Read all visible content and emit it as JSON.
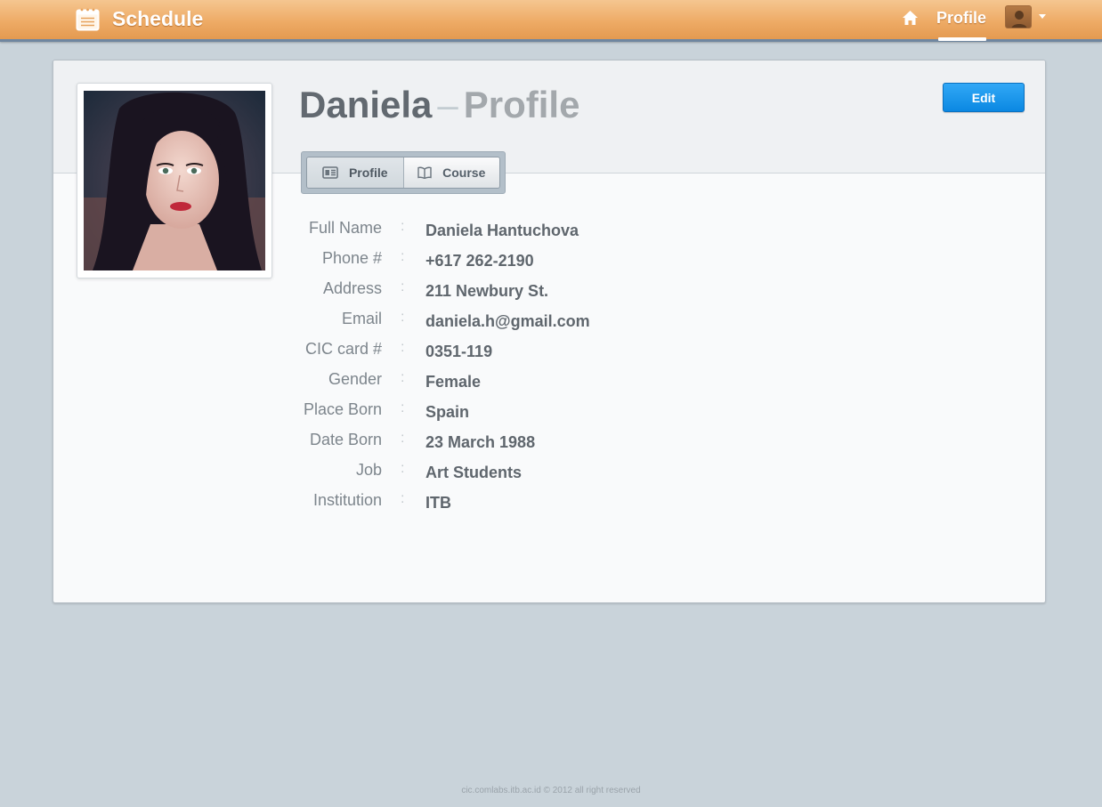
{
  "app": {
    "title": "Schedule"
  },
  "nav": {
    "profile_label": "Profile"
  },
  "profile": {
    "name": "Daniela",
    "dash": "–",
    "page_label": "Profile",
    "edit_label": "Edit"
  },
  "tabs": [
    {
      "label": "Profile",
      "icon": "id-card-icon",
      "active": true
    },
    {
      "label": "Course",
      "icon": "book-icon",
      "active": false
    }
  ],
  "details": [
    {
      "label": "Full Name",
      "value": "Daniela Hantuchova"
    },
    {
      "label": "Phone #",
      "value": "+617 262-2190"
    },
    {
      "label": "Address",
      "value": "211 Newbury St."
    },
    {
      "label": "Email",
      "value": "daniela.h@gmail.com"
    },
    {
      "label": "CIC card #",
      "value": "0351-119"
    },
    {
      "label": "Gender",
      "value": "Female"
    },
    {
      "label": "Place Born",
      "value": "Spain"
    },
    {
      "label": "Date Born",
      "value": "23 March 1988"
    },
    {
      "label": "Job",
      "value": "Art Students"
    },
    {
      "label": "Institution",
      "value": "ITB"
    }
  ],
  "separator": ":",
  "footer": {
    "text": "cic.comlabs.itb.ac.id © 2012 all right reserved"
  },
  "colors": {
    "topbar": "#eeab66",
    "accent_button": "#1898ec",
    "background": "#c9d3da"
  }
}
